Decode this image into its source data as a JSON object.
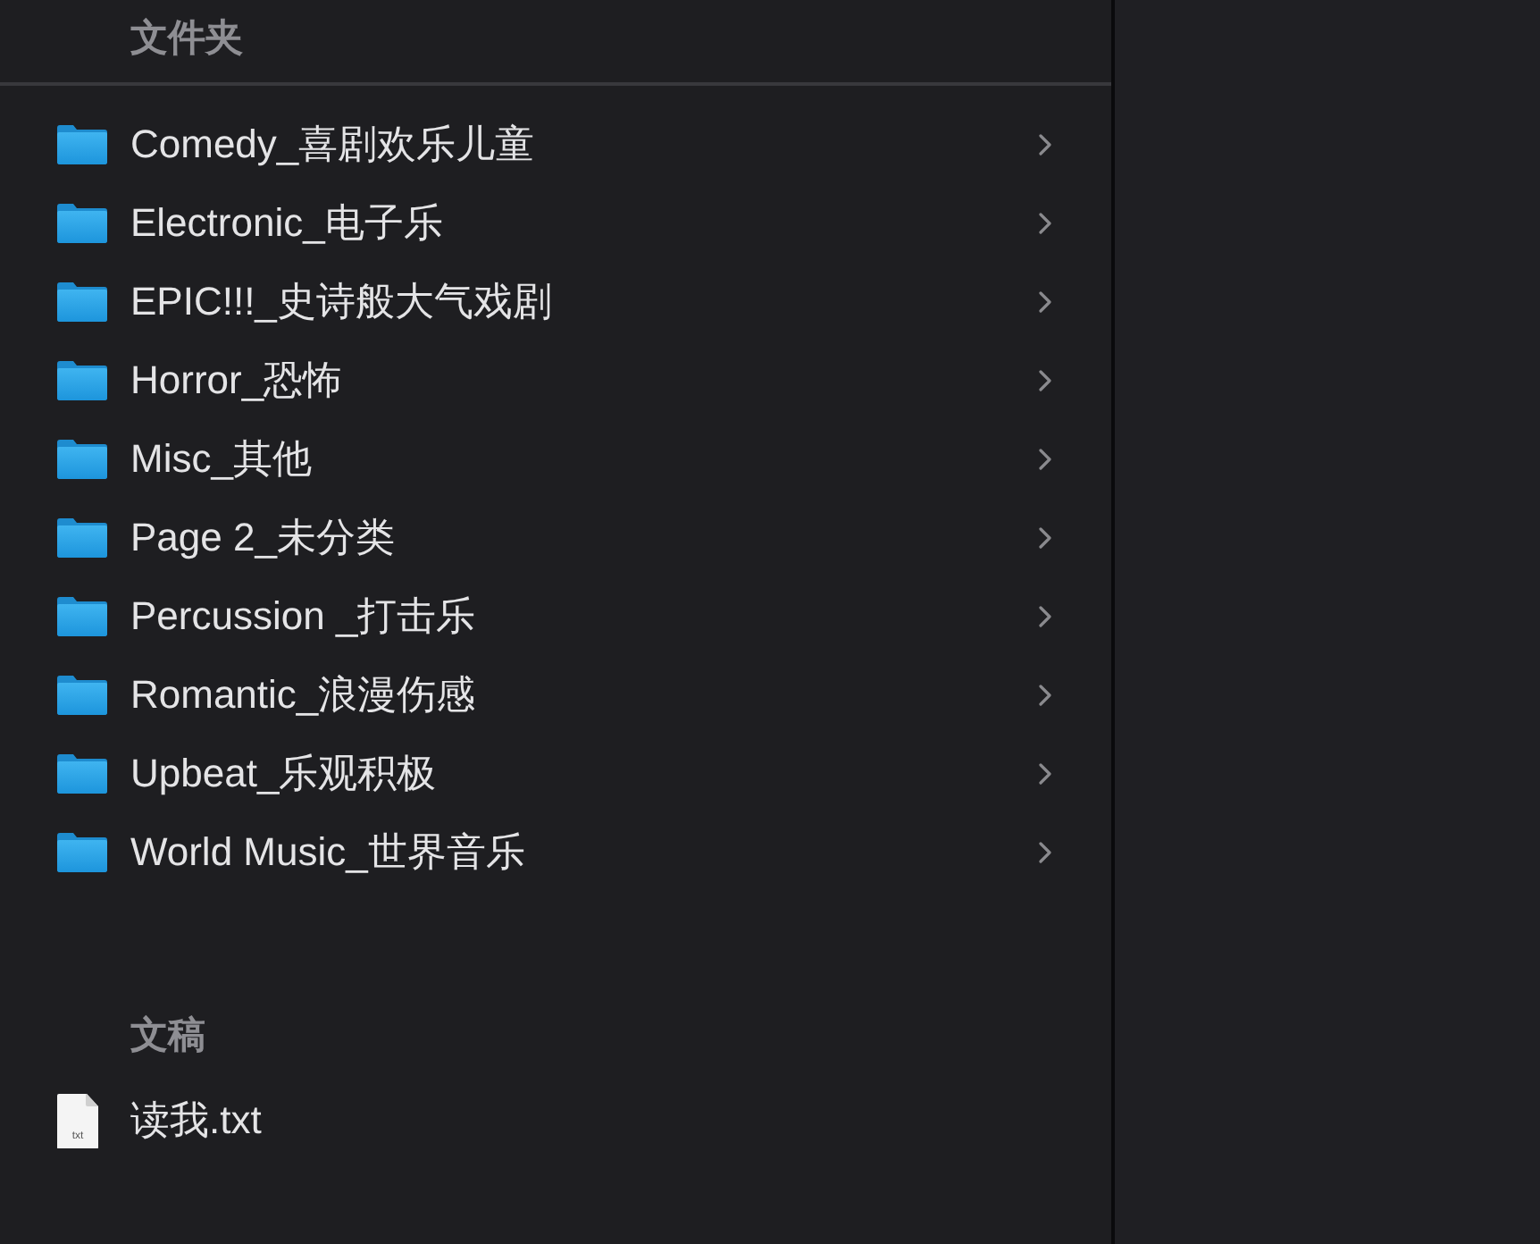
{
  "sections": [
    {
      "heading": "文件夹",
      "items": [
        {
          "kind": "folder",
          "name": "Comedy_喜剧欢乐儿童"
        },
        {
          "kind": "folder",
          "name": "Electronic_电子乐"
        },
        {
          "kind": "folder",
          "name": "EPIC!!!_史诗般大气戏剧"
        },
        {
          "kind": "folder",
          "name": "Horror_恐怖"
        },
        {
          "kind": "folder",
          "name": "Misc_其他"
        },
        {
          "kind": "folder",
          "name": "Page 2_未分类"
        },
        {
          "kind": "folder",
          "name": "Percussion _打击乐"
        },
        {
          "kind": "folder",
          "name": "Romantic_浪漫伤感"
        },
        {
          "kind": "folder",
          "name": "Upbeat_乐观积极"
        },
        {
          "kind": "folder",
          "name": "World Music_世界音乐"
        }
      ]
    },
    {
      "heading": "文稿",
      "items": [
        {
          "kind": "file",
          "name": "读我.txt",
          "icon_label": "txt"
        }
      ]
    }
  ]
}
